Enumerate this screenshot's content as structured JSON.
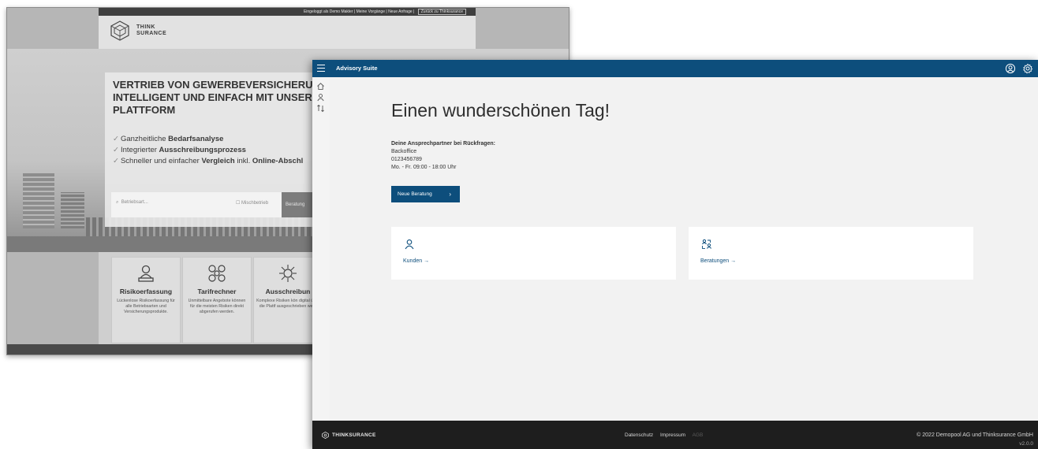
{
  "background_page": {
    "top_links": {
      "logged_in": "Eingeloggt als Demo Makler",
      "my_processes": "Meine Vorgänge",
      "new_request": "Neue Anfrage",
      "back_button": "Zurück zu Thinksurance"
    },
    "logo": {
      "line1": "THINK",
      "line2": "SURANCE"
    },
    "hero": {
      "heading_lines": [
        "VERTRIEB VON GEWERBEVERSICHERUNG",
        "INTELLIGENT UND EINFACH MIT UNSERE",
        "PLATTFORM"
      ],
      "features": [
        {
          "pre": "Ganzheitliche ",
          "bold": "Bedarfsanalyse",
          "post": ""
        },
        {
          "pre": "Integrierter ",
          "bold": "Ausschreibungsprozess",
          "post": ""
        },
        {
          "pre": "Schneller und einfacher ",
          "bold": "Vergleich",
          "post": " inkl. ",
          "bold2": "Online-Abschl"
        }
      ]
    },
    "search": {
      "placeholder": "Betriebsart...",
      "option_label": "Mischbetrieb",
      "button_label": "Beratung"
    },
    "tiles": [
      {
        "title": "Risikoerfassung",
        "desc": "Lückenlose Risikoerfassung für alle Betriebsarten und Versicherungsprodukte.",
        "icon": "laptop-user-icon"
      },
      {
        "title": "Tarifrechner",
        "desc": "Unmittelbare Angebote können für die meisten Risiken direkt abgerufen werden.",
        "icon": "network-nodes-icon"
      },
      {
        "title": "Ausschreibun",
        "desc": "Komplexe Risiken kön digital über die Plattf ausgeschrieben werd",
        "icon": "hub-icon"
      }
    ]
  },
  "app": {
    "title": "Advisory Suite",
    "greeting": "Einen wunderschönen Tag!",
    "contact": {
      "heading": "Deine Ansprechpartner bei Rückfragen:",
      "name": "Backoffice",
      "phone": "0123456789",
      "hours": "Mo. - Fr. 09:00 - 18:00 Uhr"
    },
    "new_consultation_button": "Neue Beratung",
    "cards": [
      {
        "label": "Kunden",
        "arrow": "→",
        "icon": "person-icon"
      },
      {
        "label": "Beratungen",
        "arrow": "→",
        "icon": "consultations-icon"
      }
    ],
    "footer": {
      "brand": "THINKSURANCE",
      "links": [
        "Datenschutz",
        "Impressum",
        "AGB"
      ],
      "copyright": "© 2022 Demopool AG und Thinksurance GmbH",
      "version": "v2.0.0"
    },
    "colors": {
      "primary": "#0d4e7c",
      "footer": "#1e1e1e",
      "background": "#f2f2f2"
    }
  }
}
